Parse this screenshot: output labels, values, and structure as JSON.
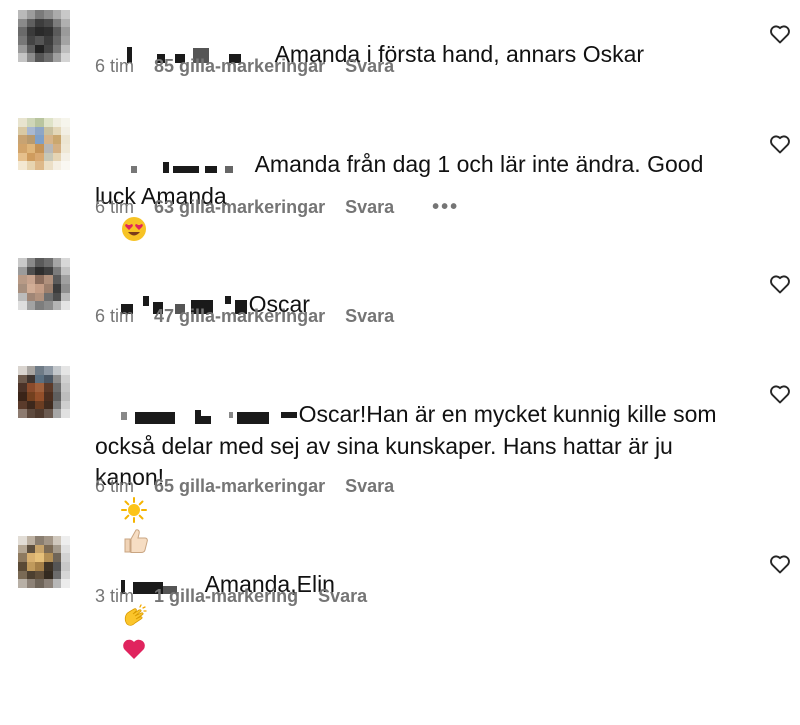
{
  "comments": [
    {
      "text": "Amanda i första hand, annars Oskar",
      "time": "6 tim",
      "likes": "85 gilla-markeringar",
      "reply": "Svara",
      "more": "",
      "emojis": []
    },
    {
      "text": "Amanda från dag 1 och lär inte ändra. Good luck Amanda",
      "time": "6 tim",
      "likes": "63 gilla-markeringar",
      "reply": "Svara",
      "more": "•••",
      "emojis": [
        "heart-eyes-emoji"
      ]
    },
    {
      "text": "Oscar",
      "time": "6 tim",
      "likes": "47 gilla-markeringar",
      "reply": "Svara",
      "more": "",
      "emojis": []
    },
    {
      "text": "Oscar!Han är en mycket kunnig kille som också delar med sej av sina kunskaper. Hans hattar är ju kanon!",
      "time": "6 tim",
      "likes": "65 gilla-markeringar",
      "reply": "Svara",
      "more": "",
      "emojis": [
        "sun-emoji",
        "thumbs-up-emoji"
      ]
    },
    {
      "text": "Amanda,Elin",
      "time": "3 tim",
      "likes": "1 gilla-markering",
      "reply": "Svara",
      "more": "",
      "emojis": [
        "clapping-hands-emoji",
        "red-heart-emoji"
      ]
    }
  ],
  "icons": {
    "like": "heart-outline-icon"
  },
  "colors": {
    "meta": "#757575",
    "text": "#111111",
    "heart_emoji": "#e0245e"
  }
}
